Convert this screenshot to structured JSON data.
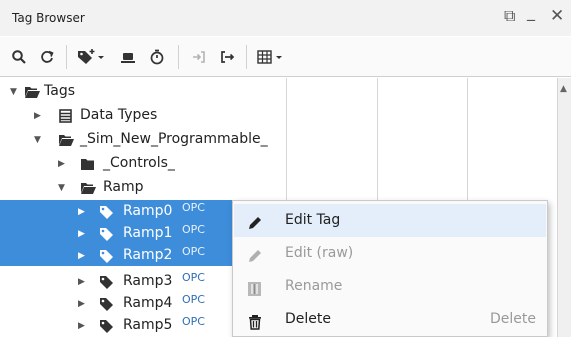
{
  "window": {
    "title": "Tag Browser",
    "controls": {
      "float": "⧉",
      "minimize": "_",
      "close": "✕"
    }
  },
  "toolbar": {
    "buttons": [
      {
        "name": "search-icon"
      },
      {
        "name": "refresh-icon"
      },
      {
        "name": "add-tag-dropdown-icon"
      },
      {
        "name": "opc-server-icon"
      },
      {
        "name": "history-icon"
      },
      {
        "name": "import-icon"
      },
      {
        "name": "export-icon"
      },
      {
        "name": "columns-dropdown-icon"
      }
    ]
  },
  "tree": {
    "nodes": [
      {
        "label": "Tags",
        "expanded": true,
        "icon": "folder-open-icon"
      },
      {
        "label": "Data Types",
        "expanded": false,
        "icon": "data-types-icon"
      },
      {
        "label": "_Sim_New_Programmable_",
        "expanded": true,
        "icon": "folder-open-icon"
      },
      {
        "label": "_Controls_",
        "expanded": false,
        "icon": "folder-icon"
      },
      {
        "label": "Ramp",
        "expanded": true,
        "icon": "folder-open-icon"
      },
      {
        "label": "Ramp0",
        "badge": "OPC",
        "selected": true,
        "icon": "tag-icon"
      },
      {
        "label": "Ramp1",
        "badge": "OPC",
        "selected": true,
        "icon": "tag-icon"
      },
      {
        "label": "Ramp2",
        "badge": "OPC",
        "selected": true,
        "icon": "tag-icon"
      },
      {
        "label": "Ramp3",
        "badge": "OPC",
        "selected": false,
        "icon": "tag-icon"
      },
      {
        "label": "Ramp4",
        "badge": "OPC",
        "selected": false,
        "icon": "tag-icon"
      },
      {
        "label": "Ramp5",
        "badge": "OPC",
        "selected": false,
        "icon": "tag-icon"
      }
    ]
  },
  "context_menu": {
    "items": [
      {
        "label": "Edit Tag",
        "shortcut": "",
        "enabled": true,
        "highlighted": true,
        "icon": "pencil-icon"
      },
      {
        "label": "Edit (raw)",
        "shortcut": "",
        "enabled": false,
        "highlighted": false,
        "icon": "pencil-icon"
      },
      {
        "label": "Rename",
        "shortcut": "",
        "enabled": false,
        "highlighted": false,
        "icon": "rename-icon"
      },
      {
        "label": "Delete",
        "shortcut": "Delete",
        "enabled": true,
        "highlighted": false,
        "icon": "trash-icon"
      }
    ]
  },
  "colors": {
    "selection": "#3d8ddb",
    "menu_highlight": "#e3eefa",
    "opc_badge": "#2f6fb4"
  }
}
